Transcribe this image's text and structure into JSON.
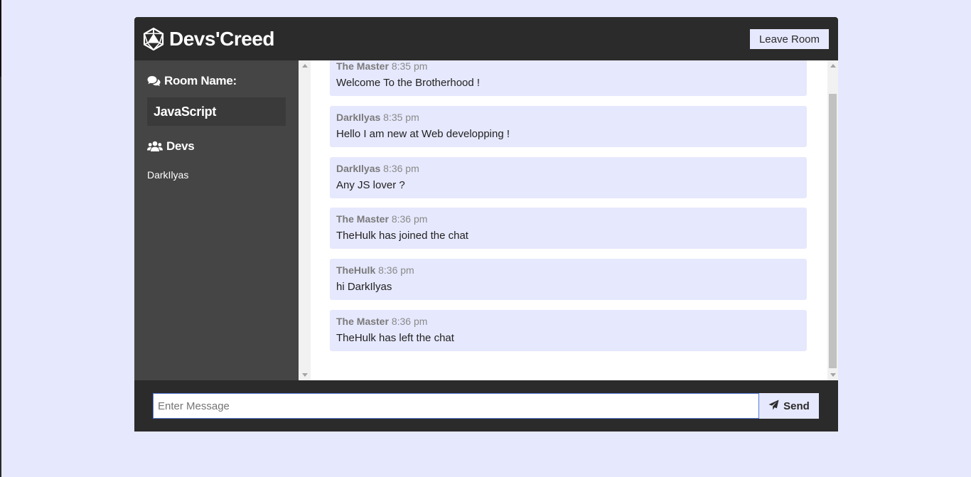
{
  "header": {
    "logo_text": "Devs'Creed",
    "leave_label": "Leave Room"
  },
  "sidebar": {
    "room_heading": "Room Name:",
    "room_name": "JavaScript",
    "devs_heading": "Devs",
    "users": [
      "DarkIlyas"
    ]
  },
  "messages": [
    {
      "author": "The Master",
      "time": "8:35 pm",
      "text": "Welcome To the Brotherhood !"
    },
    {
      "author": "DarkIlyas",
      "time": "8:35 pm",
      "text": "Hello I am new at Web developping !"
    },
    {
      "author": "DarkIlyas",
      "time": "8:36 pm",
      "text": "Any JS lover ?"
    },
    {
      "author": "The Master",
      "time": "8:36 pm",
      "text": "TheHulk has joined the chat"
    },
    {
      "author": "TheHulk",
      "time": "8:36 pm",
      "text": "hi DarkIlyas"
    },
    {
      "author": "The Master",
      "time": "8:36 pm",
      "text": "TheHulk has left the chat"
    }
  ],
  "composer": {
    "placeholder": "Enter Message",
    "send_label": "Send"
  },
  "icons": {
    "logo": "d20-dice-icon",
    "room": "comments-icon",
    "devs": "users-icon",
    "send": "paper-plane-icon"
  },
  "colors": {
    "background": "#e6e8fd",
    "header": "#2b2b2b",
    "sidebar": "#454545",
    "message_bg": "#e6e8fd"
  }
}
